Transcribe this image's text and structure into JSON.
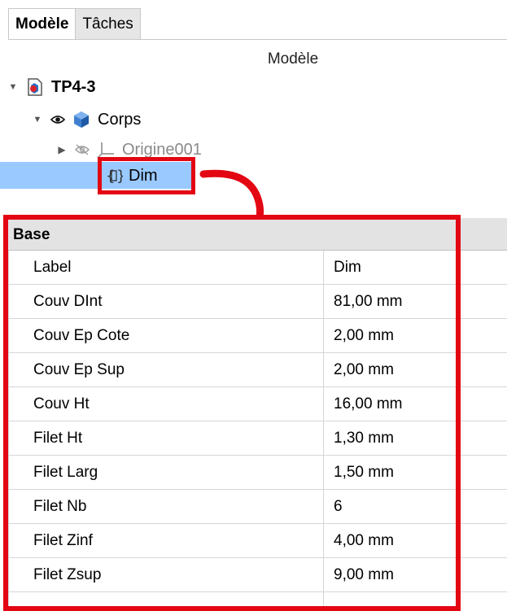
{
  "tabs": [
    {
      "label": "Modèle",
      "active": true
    },
    {
      "label": "Tâches",
      "active": false
    }
  ],
  "tree": {
    "header": "Modèle",
    "items": [
      {
        "label": "TP4-3",
        "icon": "document-icon",
        "expanded": true
      },
      {
        "label": "Corps",
        "icon": "body-icon",
        "expanded": true,
        "visibility": "eye-icon"
      },
      {
        "label": "Origine001",
        "icon": "origin-axes-icon",
        "expanded": false,
        "visibility": "eye-hidden-icon"
      },
      {
        "label": "Dim",
        "icon": "spreadsheet-braces-icon",
        "selected": true
      }
    ]
  },
  "properties": {
    "section": "Base",
    "rows": [
      {
        "name": "Label",
        "value": "Dim"
      },
      {
        "name": "Couv DInt",
        "value": "81,00 mm"
      },
      {
        "name": "Couv Ep Cote",
        "value": "2,00 mm"
      },
      {
        "name": "Couv Ep Sup",
        "value": "2,00 mm"
      },
      {
        "name": "Couv Ht",
        "value": "16,00 mm"
      },
      {
        "name": "Filet Ht",
        "value": "1,30 mm"
      },
      {
        "name": "Filet Larg",
        "value": "1,50 mm"
      },
      {
        "name": "Filet Nb",
        "value": "6"
      },
      {
        "name": "Filet Zinf",
        "value": "4,00 mm"
      },
      {
        "name": "Filet Zsup",
        "value": "9,00 mm"
      }
    ]
  },
  "colors": {
    "highlight": "#e30613",
    "selection": "#99c9ff"
  }
}
